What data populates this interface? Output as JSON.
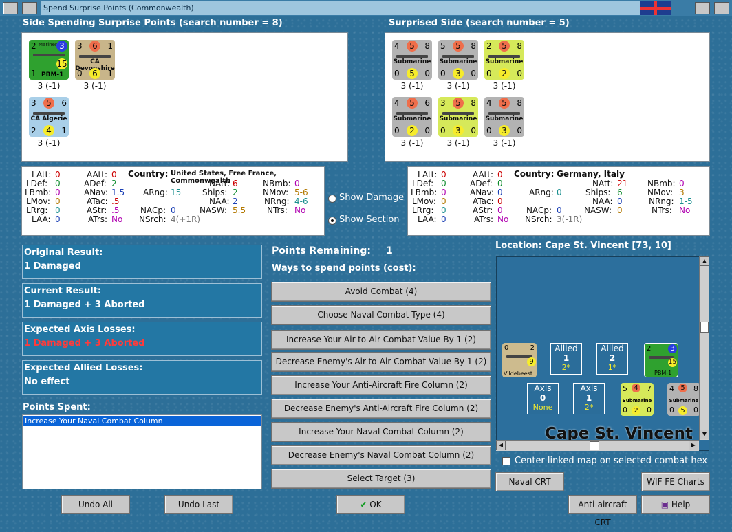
{
  "window": {
    "title": "Spend Surprise Points (Commonwealth)"
  },
  "spending": {
    "header": "Side Spending Surprise Points (search number = 8)",
    "units": [
      {
        "name": "PBM-1",
        "tag": "Mariner",
        "tl": "2",
        "tr": "3",
        "bl": "1",
        "mid": "15",
        "caption": "3 (-1)",
        "color": "#2fa12f"
      },
      {
        "name": "CA Devonshire",
        "tl": "3",
        "top": "6",
        "tr": "1",
        "bl": "0",
        "mid": "6",
        "br": "1",
        "caption": "3 (-1)",
        "color": "#c8b58a"
      },
      {
        "name": "CA Algerie",
        "tl": "3",
        "top": "5",
        "tr": "6",
        "bl": "2",
        "mid": "4",
        "br": "1",
        "caption": "3 (-1)",
        "color": "#a9cfe8"
      }
    ]
  },
  "surprised": {
    "header": "Surprised Side (search number = 5)",
    "units": [
      {
        "name": "Submarine",
        "tl": "4",
        "top": "5",
        "tr": "8",
        "bl": "0",
        "mid": "5",
        "br": "0",
        "caption": "3 (-1)",
        "color": "#b3b3b3"
      },
      {
        "name": "Submarine",
        "tl": "5",
        "top": "5",
        "tr": "8",
        "bl": "0",
        "mid": "3",
        "br": "0",
        "caption": "3 (-1)",
        "color": "#b3b3b3"
      },
      {
        "name": "Submarine",
        "tl": "2",
        "top": "5",
        "tr": "8",
        "bl": "0",
        "mid": "2",
        "br": "0",
        "caption": "3 (-1)",
        "color": "#d6e95a"
      },
      {
        "name": "Submarine",
        "tl": "4",
        "top": "5",
        "tr": "6",
        "bl": "0",
        "mid": "2",
        "br": "0",
        "caption": "3 (-1)",
        "color": "#b3b3b3"
      },
      {
        "name": "Submarine",
        "tl": "3",
        "top": "5",
        "tr": "8",
        "bl": "0",
        "mid": "3",
        "br": "0",
        "caption": "3 (-1)",
        "color": "#d6e95a"
      },
      {
        "name": "Submarine",
        "tl": "4",
        "top": "5",
        "tr": "8",
        "bl": "0",
        "mid": "3",
        "br": "0",
        "caption": "3 (-1)",
        "color": "#b3b3b3"
      }
    ]
  },
  "stats_left": {
    "country_label": "Country:",
    "country": "United States, Free France, Commonwealth",
    "latt": "0",
    "atatt": "0",
    "ldef": "0",
    "adef": "2",
    "lbmb": "0",
    "anav": "1.5",
    "arng": "15",
    "lmov": "0",
    "atac": ".5",
    "lrng": "0",
    "astr": ".5",
    "laa": "0",
    "atrs": "No",
    "natt": "6",
    "nbmb": "0",
    "ships": "2",
    "nmov": "5-6",
    "naa": "2",
    "nrng": "4-6",
    "nacp": "0",
    "nasw": "5.5",
    "ntrs": "No",
    "nsrch": "4(+1R)"
  },
  "stats_right": {
    "country_label": "Country:",
    "country": "Germany, Italy",
    "latt": "0",
    "atatt": "0",
    "ldef": "0",
    "adef": "0",
    "lbmb": "0",
    "anav": "0",
    "arng": "0",
    "lmov": "0",
    "atac": "0",
    "lrng": "0",
    "astr": "0",
    "laa": "0",
    "atrs": "No",
    "natt": "21",
    "nbmb": "0",
    "ships": "6",
    "nmov": "3",
    "naa": "0",
    "nrng": "1-5",
    "nacp": "0",
    "nasw": "0",
    "ntrs": "No",
    "nsrch": "3(-1R)"
  },
  "labels": {
    "latt": "LAtt:",
    "aatt": "AAtt:",
    "ldef": "LDef:",
    "adef": "ADef:",
    "lbmb": "LBmb:",
    "anav": "ANav:",
    "arng": "ARng:",
    "lmov": "LMov:",
    "atac": "ATac:",
    "lrng": "LRrg:",
    "astr": "AStr:",
    "laa": "LAA:",
    "atrs": "ATrs:",
    "natt": "NAtt:",
    "nbmb": "NBmb:",
    "ships": "Ships:",
    "nmov": "NMov:",
    "naa": "NAA:",
    "nrng": "NRng:",
    "nacp": "NACp:",
    "nasw": "NASW:",
    "ntrs": "NTrs:",
    "nsrch": "NSrch:"
  },
  "options": {
    "show_damage": "Show Damage",
    "show_section": "Show Section",
    "selected": "show_section"
  },
  "results": {
    "original_label": "Original Result:",
    "original": "1 Damaged",
    "current_label": "Current Result:",
    "current": "1 Damaged + 3 Aborted",
    "axis_label": "Expected Axis Losses:",
    "axis": "1 Damaged + 3 Aborted",
    "allied_label": "Expected Allied Losses:",
    "allied": "No effect"
  },
  "points_spent": {
    "label": "Points Spent:",
    "items": [
      "Increase Your Naval Combat Column"
    ]
  },
  "points": {
    "remaining_label": "Points Remaining:",
    "remaining": "1",
    "ways_label": "Ways to spend points (cost):"
  },
  "spend_options": [
    "Avoid Combat (4)",
    "Choose Naval Combat Type (4)",
    "Increase Your Air-to-Air Combat Value By 1 (2)",
    "Decrease Enemy's Air-to-Air Combat Value By 1 (2)",
    "Increase Your Anti-Aircraft Fire Column (2)",
    "Decrease Enemy's Anti-Aircraft Fire Column (2)",
    "Increase Your Naval Combat Column (2)",
    "Decrease Enemy's Naval Combat Column (2)",
    "Select Target (3)"
  ],
  "map": {
    "location": "Location: Cape St. Vincent [73, 10]",
    "place": "Cape St. Vincent",
    "center_label": "Center linked map on selected combat hex",
    "boxes": [
      {
        "side": "Allied",
        "num": "1",
        "sub": "2*"
      },
      {
        "side": "Allied",
        "num": "2",
        "sub": "1*"
      },
      {
        "side": "Axis",
        "num": "0",
        "sub": "None"
      },
      {
        "side": "Axis",
        "num": "1",
        "sub": "2*"
      }
    ],
    "counter_labels": {
      "vildebeest": "Vildebeest",
      "pbm": "PBM-1",
      "sub": "Submarine"
    }
  },
  "buttons": {
    "undo_all": "Undo All",
    "undo_last": "Undo Last",
    "ok": "OK",
    "naval_crt": "Naval CRT",
    "wif_charts": "WIF FE Charts",
    "aa_crt": "Anti-aircraft CRT",
    "help": "Help"
  }
}
